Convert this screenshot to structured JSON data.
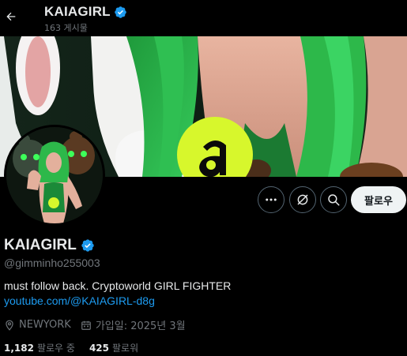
{
  "header": {
    "title": "KAIAGIRL",
    "posts_count": "163 게시물"
  },
  "profile": {
    "display_name": "KAIAGIRL",
    "handle": "@gimminho255003",
    "bio": "must follow back. Cryptoworld GIRL FIGHTER",
    "link": "youtube.com/@KAIAGIRL-d8g",
    "location": "NEWYORK",
    "joined": "가입일: 2025년 3월",
    "following_count": "1,182",
    "following_label": "팔로우 중",
    "followers_count": "425",
    "followers_label": "팔로워"
  },
  "actions": {
    "follow_label": "팔로우"
  },
  "icons": {
    "back": "arrow-left-icon",
    "verified": "verified-badge-icon",
    "more": "more-icon",
    "subscribe": "subscribe-icon",
    "search": "search-icon",
    "location": "location-icon",
    "calendar": "calendar-icon"
  },
  "colors": {
    "accent": "#1d9bf0",
    "verified": "#1d9bf0",
    "muted": "#71767b",
    "banner_green": "#2db84a",
    "logo_yellow": "#d7f72c"
  }
}
